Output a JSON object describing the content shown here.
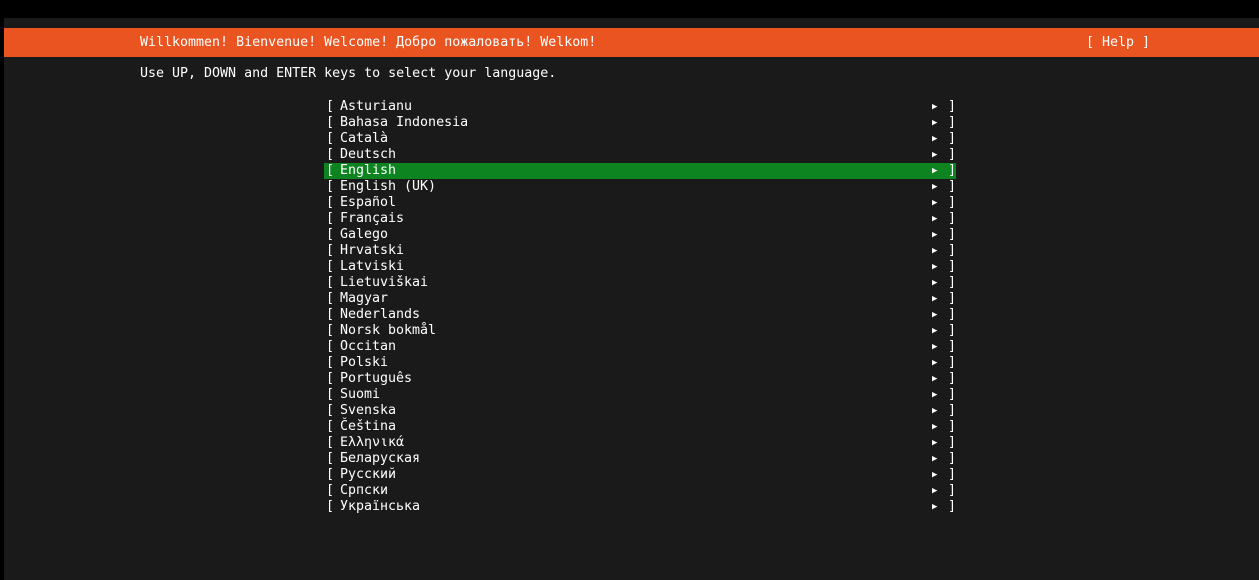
{
  "header": {
    "title": "Willkommen! Bienvenue! Welcome! Добро пожаловать! Welkom!",
    "help_label": "[ Help ]"
  },
  "instructions": "Use UP, DOWN and ENTER keys to select your language.",
  "colors": {
    "header_bg": "#e95420",
    "selected_bg": "#0e8420",
    "console_bg": "#1a1a1a",
    "text": "#ffffff"
  },
  "languages": [
    {
      "label": "Asturianu",
      "selected": false
    },
    {
      "label": "Bahasa Indonesia",
      "selected": false
    },
    {
      "label": "Català",
      "selected": false
    },
    {
      "label": "Deutsch",
      "selected": false
    },
    {
      "label": "English",
      "selected": true
    },
    {
      "label": "English (UK)",
      "selected": false
    },
    {
      "label": "Español",
      "selected": false
    },
    {
      "label": "Français",
      "selected": false
    },
    {
      "label": "Galego",
      "selected": false
    },
    {
      "label": "Hrvatski",
      "selected": false
    },
    {
      "label": "Latviski",
      "selected": false
    },
    {
      "label": "Lietuviškai",
      "selected": false
    },
    {
      "label": "Magyar",
      "selected": false
    },
    {
      "label": "Nederlands",
      "selected": false
    },
    {
      "label": "Norsk bokmål",
      "selected": false
    },
    {
      "label": "Occitan",
      "selected": false
    },
    {
      "label": "Polski",
      "selected": false
    },
    {
      "label": "Português",
      "selected": false
    },
    {
      "label": "Suomi",
      "selected": false
    },
    {
      "label": "Svenska",
      "selected": false
    },
    {
      "label": "Čeština",
      "selected": false
    },
    {
      "label": "Ελληνικά",
      "selected": false
    },
    {
      "label": "Беларуская",
      "selected": false
    },
    {
      "label": "Русский",
      "selected": false
    },
    {
      "label": "Српски",
      "selected": false
    },
    {
      "label": "Українська",
      "selected": false
    }
  ],
  "item_bracket_open": "[",
  "item_bracket_close": "]",
  "item_arrow": "▶"
}
